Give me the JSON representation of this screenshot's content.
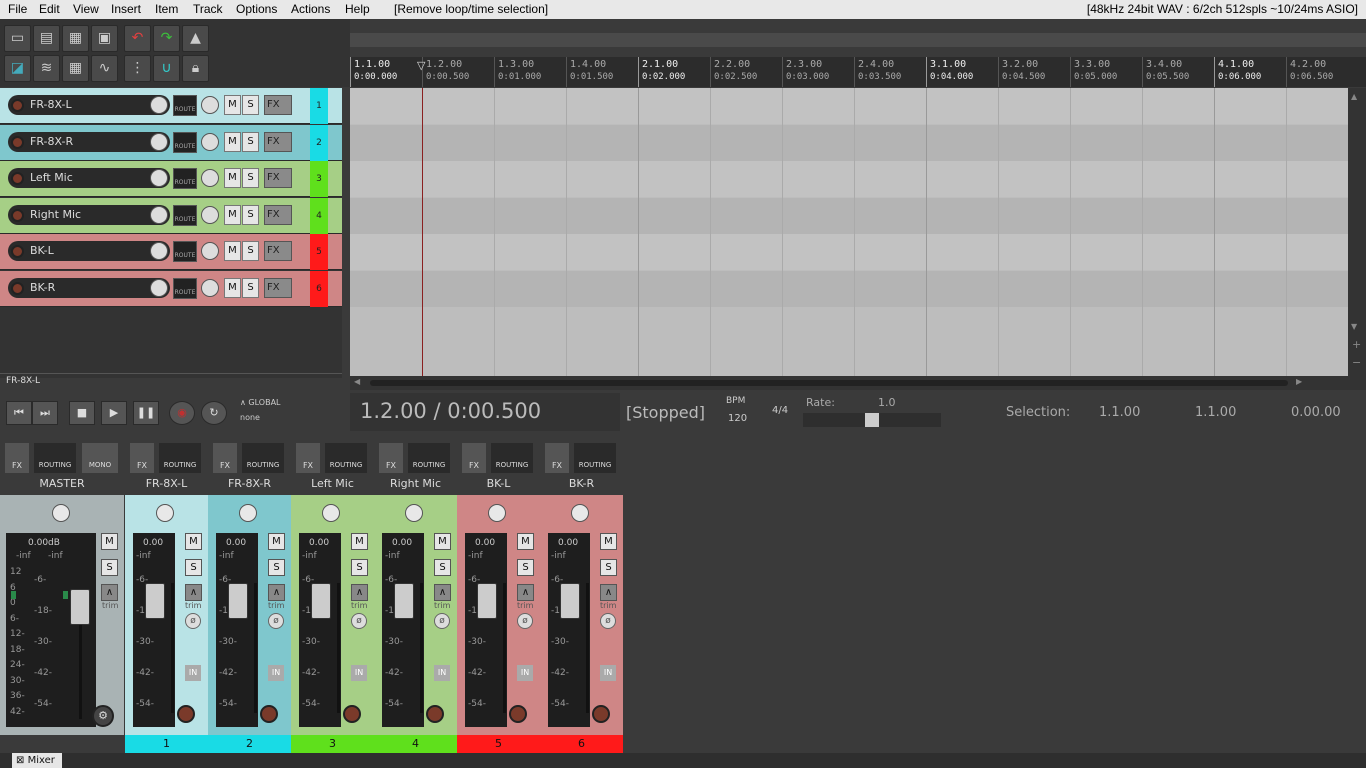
{
  "menu": {
    "items": [
      "File",
      "Edit",
      "View",
      "Insert",
      "Item",
      "Track",
      "Options",
      "Actions",
      "Help"
    ],
    "last_action": "[Remove loop/time selection]",
    "status": "[48kHz 24bit WAV : 6/2ch 512spls ~10/24ms ASIO]"
  },
  "tracks": [
    {
      "name": "FR-8X-L",
      "num": "1",
      "color": "#b9e3e6",
      "numcolor": "#19dbe5"
    },
    {
      "name": "FR-8X-R",
      "num": "2",
      "color": "#7fc7cd",
      "numcolor": "#19dbe5"
    },
    {
      "name": "Left Mic",
      "num": "3",
      "color": "#a6cf86",
      "numcolor": "#5fe01c"
    },
    {
      "name": "Right Mic",
      "num": "4",
      "color": "#a6cf86",
      "numcolor": "#5fe01c"
    },
    {
      "name": "BK-L",
      "num": "5",
      "color": "#cf8686",
      "numcolor": "#ff1a1a"
    },
    {
      "name": "BK-R",
      "num": "6",
      "color": "#cf8686",
      "numcolor": "#ff1a1a"
    }
  ],
  "buttons": {
    "route": "ROUTE",
    "mute": "M",
    "solo": "S",
    "fx": "FX",
    "routing": "ROUTING",
    "mono": "MONO",
    "trim": "trim"
  },
  "ruler": {
    "marks": [
      {
        "bar": "1.1.00",
        "time": "0:00.000",
        "main": true
      },
      {
        "bar": "1.2.00",
        "time": "0:00.500"
      },
      {
        "bar": "1.3.00",
        "time": "0:01.000"
      },
      {
        "bar": "1.4.00",
        "time": "0:01.500"
      },
      {
        "bar": "2.1.00",
        "time": "0:02.000",
        "main": true
      },
      {
        "bar": "2.2.00",
        "time": "0:02.500"
      },
      {
        "bar": "2.3.00",
        "time": "0:03.000"
      },
      {
        "bar": "2.4.00",
        "time": "0:03.500"
      },
      {
        "bar": "3.1.00",
        "time": "0:04.000",
        "main": true
      },
      {
        "bar": "3.2.00",
        "time": "0:04.500"
      },
      {
        "bar": "3.3.00",
        "time": "0:05.000"
      },
      {
        "bar": "3.4.00",
        "time": "0:05.500"
      },
      {
        "bar": "4.1.00",
        "time": "0:06.000",
        "main": true
      },
      {
        "bar": "4.2.00",
        "time": "0:06.500"
      }
    ]
  },
  "selected_track": "FR-8X-L",
  "transport": {
    "position": "1.2.00 / 0:00.500",
    "state": "[Stopped]",
    "bpm_label": "BPM",
    "bpm": "120",
    "timesig": "4/4",
    "rate_label": "Rate:",
    "rate": "1.0",
    "global": "GLOBAL",
    "global_mode": "none",
    "selection_label": "Selection:",
    "sel_start": "1.1.00",
    "sel_end": "1.1.00",
    "sel_len": "0.00.00"
  },
  "mixer": {
    "master": "MASTER",
    "master_db": "0.00dB",
    "track_db": "0.00",
    "neg_inf": "-inf",
    "scale": [
      "-6-",
      "-18-",
      "-30-",
      "-42-",
      "-54-"
    ],
    "master_scale_left": [
      "12",
      "6",
      "0",
      "6-",
      "12-",
      "18-",
      "24-",
      "30-",
      "36-",
      "42-"
    ],
    "master_scale_mid": [
      "-6-",
      "-18-",
      "-30-",
      "-42-",
      "-54-"
    ]
  },
  "bottom_tab": "Mixer"
}
